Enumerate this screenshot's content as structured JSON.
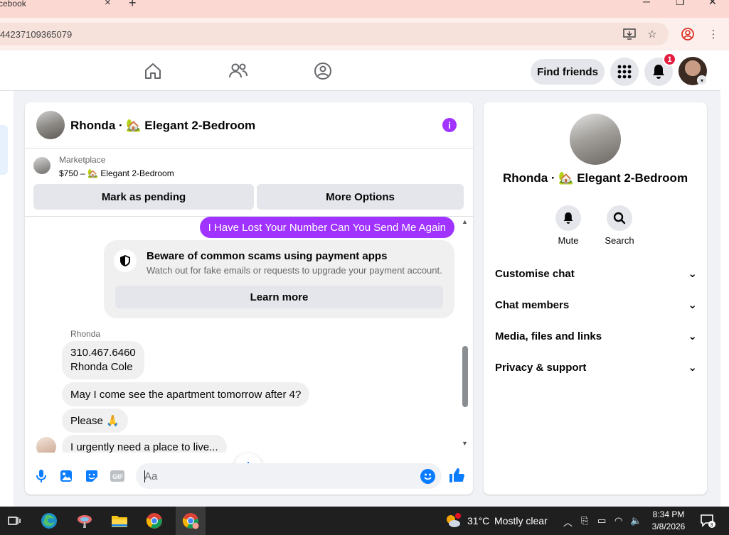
{
  "browser": {
    "tab_title": "cebook",
    "tab_close": "×",
    "new_tab": "+",
    "url": "44237109365079",
    "win_min": "─",
    "win_restore": "❐",
    "win_close": "✕"
  },
  "fbnav": {
    "find_friends": "Find friends",
    "notification_count": "1"
  },
  "chat": {
    "title": "Rhonda · 🏡 Elegant 2-Bedroom",
    "marketplace_label": "Marketplace",
    "listing": "$750 – 🏡 Elegant 2-Bedroom",
    "mark_pending": "Mark as pending",
    "more_options": "More Options",
    "messages": {
      "outgoing_1": "I Have Lost Your Number Can You Send Me Again",
      "scam_title": "Beware of common scams using payment apps",
      "scam_body": "Watch out for fake emails or requests to upgrade your payment account.",
      "learn_more": "Learn more",
      "sender_name": "Rhonda",
      "in_1_line1": "310.467.6460",
      "in_1_line2": "Rhonda Cole",
      "in_2": "May I come see the apartment tomorrow after 4?",
      "in_3": "Please 🙏",
      "in_4": "I urgently need a place to live..."
    },
    "composer_placeholder": "Aa"
  },
  "rpanel": {
    "name": "Rhonda · 🏡 Elegant 2-Bedroom",
    "mute": "Mute",
    "search": "Search",
    "sections": [
      "Customise chat",
      "Chat members",
      "Media, files and links",
      "Privacy & support"
    ]
  },
  "taskbar": {
    "temp": "31°C",
    "weather": "Mostly clear",
    "time": "8:34 PM",
    "date": "3/8/2026",
    "notif_count": "3"
  },
  "colors": {
    "accent_purple": "#a033ff",
    "messenger_blue": "#0a7cff",
    "badge_red": "#e41e3f"
  }
}
